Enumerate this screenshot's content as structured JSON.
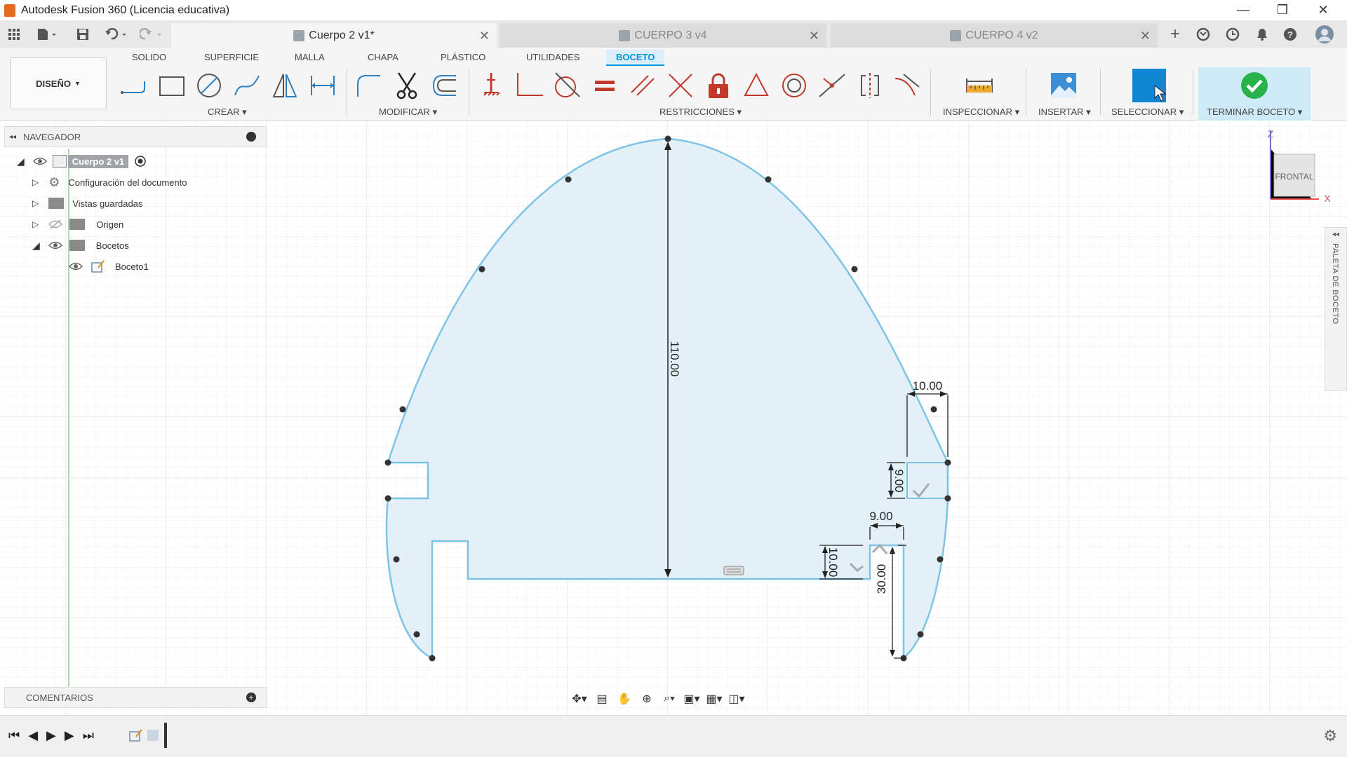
{
  "window": {
    "title": "Autodesk Fusion 360 (Licencia educativa)",
    "controls": {
      "minimize": "—",
      "maximize": "❐",
      "close": "✕"
    }
  },
  "documents": {
    "tabs": [
      {
        "label": "Cuerpo 2 v1*",
        "active": true
      },
      {
        "label": "CUERPO 3 v4",
        "active": false
      },
      {
        "label": "CUERPO 4 v2",
        "active": false
      }
    ],
    "new_tab": "+"
  },
  "toolbar": {
    "design_label": "DISEÑO",
    "workspace_tabs": [
      "SOLIDO",
      "SUPERFICIE",
      "MALLA",
      "CHAPA",
      "PLÁSTICO",
      "UTILIDADES",
      "BOCETO"
    ],
    "active_tab": "BOCETO",
    "groups": {
      "crear": "CREAR",
      "modificar": "MODIFICAR",
      "restricciones": "RESTRICCIONES",
      "inspeccionar": "INSPECCIONAR",
      "insertar": "INSERTAR",
      "seleccionar": "SELECCIONAR",
      "terminar": "TERMINAR BOCETO"
    }
  },
  "browser": {
    "header": "NAVEGADOR",
    "root": "Cuerpo 2 v1",
    "items": [
      {
        "label": "Configuración del documento"
      },
      {
        "label": "Vistas guardadas"
      },
      {
        "label": "Origen"
      },
      {
        "label": "Bocetos"
      },
      {
        "label": "Boceto1"
      }
    ]
  },
  "comments": {
    "header": "COMENTARIOS"
  },
  "viewcube": {
    "face": "FRONTAL",
    "z_label": "Z",
    "x_label": "X"
  },
  "sketch_palette": {
    "label": "PALETA DE BOCETO"
  },
  "dimensions": {
    "height": "110.00",
    "top_width": "10.00",
    "slot_height": "9.00",
    "notch_width": "9.00",
    "notch_height": "10.00",
    "leg_height": "30.00"
  },
  "colors": {
    "accent": "#0696d7",
    "profile_fill": "#e3f0f8",
    "sketch_line": "#7ec3e6",
    "finish_check": "#27b24a"
  }
}
